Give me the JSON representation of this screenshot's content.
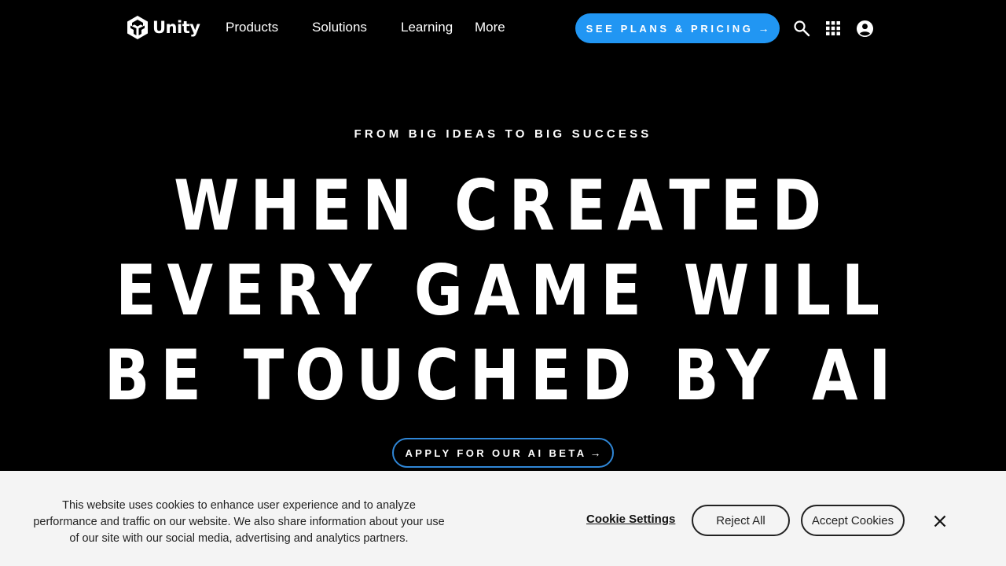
{
  "nav": {
    "logo_text": "Unity",
    "items": [
      "Products",
      "Solutions",
      "Learning",
      "More"
    ],
    "pricing_button": "SEE PLANS & PRICING",
    "arrow": "→",
    "icons": [
      "search-icon",
      "apps-grid-icon",
      "account-icon"
    ]
  },
  "hero": {
    "eyebrow": "FROM BIG IDEAS TO BIG SUCCESS",
    "headline_lines": [
      "WHEN CREATED",
      "EVERY GAME WILL",
      "BE TOUCHED BY AI"
    ],
    "cta_label": "APPLY FOR OUR AI BETA",
    "cta_arrow": "→"
  },
  "cookie_banner": {
    "message": "This website uses cookies to enhance user experience and to analyze performance and traffic on our website. We also share information about your use of our site with our social media, advertising and analytics partners.",
    "settings_link": "Cookie Settings",
    "reject_button": "Reject All",
    "accept_button": "Accept Cookies"
  },
  "colors": {
    "background": "#000000",
    "accent": "#2196f3",
    "beta_border": "#2f86d6",
    "banner_bg": "#f4f4f4"
  }
}
